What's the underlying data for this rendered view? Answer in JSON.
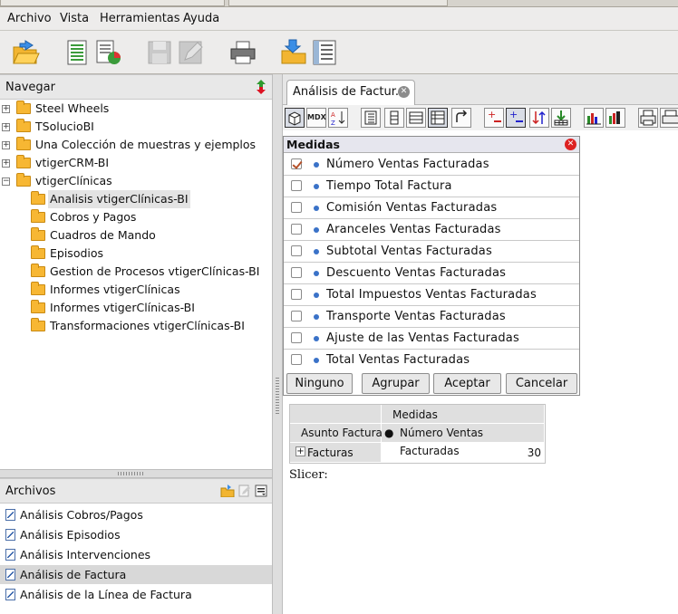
{
  "menu": [
    "Archivo",
    "Vista",
    "Herramientas",
    "Ayuda"
  ],
  "navigate": {
    "title": "Navegar",
    "items": [
      {
        "label": "Steel Wheels",
        "expanded": false
      },
      {
        "label": "TSolucioBI",
        "expanded": false
      },
      {
        "label": "Una Colección de muestras y ejemplos",
        "expanded": false
      },
      {
        "label": "vtigerCRM-BI",
        "expanded": false
      },
      {
        "label": "vtigerClínicas",
        "expanded": true
      }
    ],
    "children": [
      "Analisis vtigerClínicas-BI",
      "Cobros y Pagos",
      "Cuadros de Mando",
      "Episodios",
      "Gestion de Procesos vtigerClínicas-BI",
      "Informes vtigerClínicas",
      "Informes vtigerClínicas-BI",
      "Transformaciones vtigerClínicas-BI"
    ]
  },
  "files": {
    "title": "Archivos",
    "items": [
      "Análisis Cobros/Pagos",
      "Análisis Episodios",
      "Análisis Intervenciones",
      "Análisis de Factura",
      "Análisis de la Línea de Factura"
    ],
    "selected_index": 3
  },
  "doc_tab": {
    "label": "Análisis de Factur.."
  },
  "pivot_toolbar": {
    "mdx": "MDX"
  },
  "measures": {
    "title": "Medidas",
    "items": [
      {
        "label": "Número Ventas Facturadas",
        "checked": true
      },
      {
        "label": "Tiempo Total Factura",
        "checked": false
      },
      {
        "label": "Comisión Ventas Facturadas",
        "checked": false
      },
      {
        "label": "Aranceles Ventas Facturadas",
        "checked": false
      },
      {
        "label": "Subtotal Ventas Facturadas",
        "checked": false
      },
      {
        "label": "Descuento Ventas Facturadas",
        "checked": false
      },
      {
        "label": "Total Impuestos Ventas Facturadas",
        "checked": false
      },
      {
        "label": "Transporte Ventas Facturadas",
        "checked": false
      },
      {
        "label": "Ajuste de las Ventas Facturadas",
        "checked": false
      },
      {
        "label": "Total Ventas Facturadas",
        "checked": false
      }
    ],
    "buttons": {
      "none": "Ninguno",
      "add": "Agrupar",
      "ok": "Aceptar",
      "cancel": "Cancelar"
    }
  },
  "pivot": {
    "header_measures": "Medidas",
    "row_header": "Asunto Factura",
    "measure_col": "Número Ventas Facturadas",
    "row_label": "Facturas",
    "value": "30"
  },
  "slicer_label": "Slicer:",
  "colors": {
    "accent": "#3a72c8",
    "folder": "#f7b733",
    "close_red": "#dd2222"
  }
}
